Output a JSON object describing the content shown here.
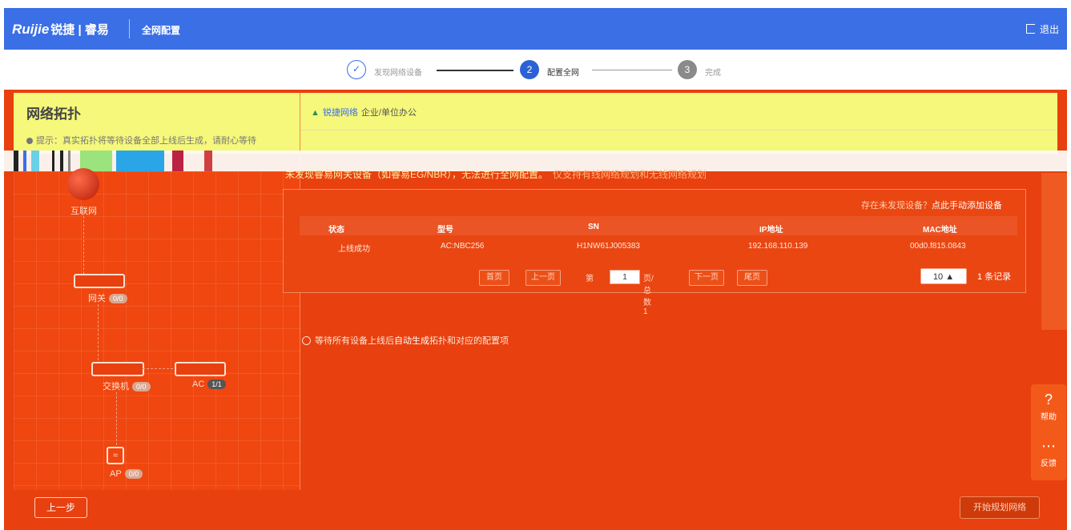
{
  "header": {
    "logo_brand": "Ruijie",
    "logo_cn": "锐捷 | 睿易",
    "nav_title": "全网配置",
    "logout_label": "退出"
  },
  "steps": [
    {
      "index": "✓",
      "label": "发现网络设备",
      "state": "done"
    },
    {
      "index": "2",
      "label": "配置全网",
      "state": "active"
    },
    {
      "index": "3",
      "label": "完成",
      "state": "todo"
    }
  ],
  "left_panel": {
    "title": "网络拓扑",
    "tip": "提示：真实拓扑将等待设备全部上线后生成，请耐心等待",
    "nodes": {
      "internet": {
        "label": "互联网"
      },
      "gateway": {
        "label": "网关",
        "badge": "0/0"
      },
      "switch": {
        "label": "交换机",
        "badge": "0/0"
      },
      "ac": {
        "label": "AC",
        "badge": "1/1"
      },
      "ap": {
        "label": "AP",
        "badge": "0/0"
      }
    }
  },
  "right_panel": {
    "net_link": "锐捷网络",
    "net_scene": "企业/单位办公",
    "warning_main": "未发现睿易网关设备（如睿易EG/NBR），无法进行全网配置。",
    "warning_hint": "仅支持有线网络规划和无线网络规划",
    "add_device_prompt": "存在未发现设备？",
    "add_device_link": "点此手动添加设备",
    "table": {
      "columns": [
        "状态",
        "型号",
        "SN",
        "IP地址",
        "MAC地址"
      ],
      "rows": [
        [
          "上线成功",
          "AC:NBC256",
          "H1NW61J005383",
          "192.168.110.139",
          "00d0.f815.0843"
        ]
      ]
    },
    "pager": {
      "first": "首页",
      "prev": "上一页",
      "page_prefix": "第",
      "page_value": "1",
      "page_suffix": "页/总数 1",
      "next": "下一页",
      "last": "尾页",
      "page_size": "10",
      "total": "1 条记录"
    },
    "wait_message_a": "等待所有设备上线后",
    "wait_message_b": "自动生成",
    "wait_message_c": "拓扑和对应的配置项"
  },
  "side": {
    "help_label": "帮助",
    "feedback_label": "反馈"
  },
  "footer": {
    "prev_label": "上一步",
    "plan_label": "开始规划网络"
  },
  "colors": {
    "header_blue": "#3b6fe6",
    "overlay_red": "#e8400f",
    "highlight_yellow": "#f5f87a"
  }
}
